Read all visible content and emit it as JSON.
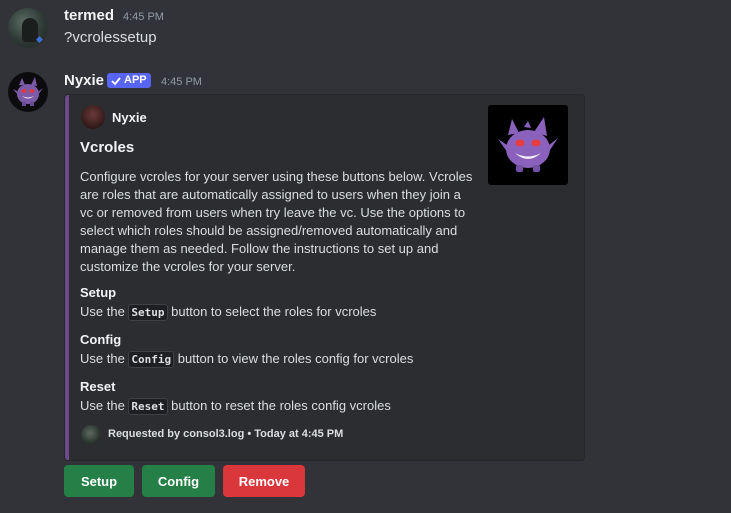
{
  "messages": [
    {
      "username": "termed",
      "timestamp": "4:45 PM",
      "text": "?vcrolessetup"
    },
    {
      "username": "Nyxie",
      "badge": "APP",
      "timestamp": "4:45 PM",
      "embed": {
        "author": "Nyxie",
        "title": "Vcroles",
        "description": "Configure vcroles for your server using these buttons below. Vcroles are roles that are automatically assigned to users when they join a vc or removed from users when try leave the vc. Use the options to select which roles should be assigned/removed automatically and manage them as needed. Follow the instructions to set up and customize the vcroles for your server.",
        "fields": [
          {
            "name": "Setup",
            "prefix": "Use the ",
            "code": "Setup",
            "suffix": " button to select the roles for vcroles"
          },
          {
            "name": "Config",
            "prefix": "Use the ",
            "code": "Config",
            "suffix": " button to view the roles config for vcroles"
          },
          {
            "name": "Reset",
            "prefix": "Use the ",
            "code": "Reset",
            "suffix": " button to reset the roles config vcroles"
          }
        ],
        "footer": "Requested by consol3.log • Today at 4:45 PM",
        "accent_color": "#6b4a8a"
      },
      "buttons": [
        {
          "label": "Setup",
          "style": "success"
        },
        {
          "label": "Config",
          "style": "success"
        },
        {
          "label": "Remove",
          "style": "danger"
        }
      ]
    }
  ],
  "colors": {
    "background": "#313338",
    "embed_background": "#2b2d31",
    "badge": "#5865f2",
    "success": "#248046",
    "danger": "#da373c"
  },
  "icons": {
    "badge_icon": "checkmark-icon"
  }
}
